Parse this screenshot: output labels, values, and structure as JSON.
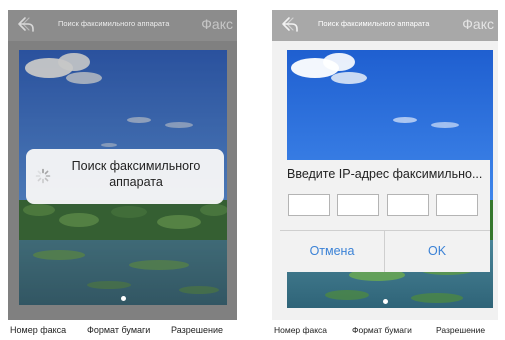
{
  "left_screen": {
    "nav_title": "Поиск факсимильного аппарата",
    "nav_right": "Факс",
    "popup_text": "Поиск факсимильного аппарата",
    "tabs": [
      "Номер факса",
      "Формат бумаги",
      "Разрешение"
    ]
  },
  "right_screen": {
    "nav_title": "Поиск факсимильного аппарата",
    "nav_right": "Факс",
    "dialog_title": "Введите IP-адрес факсимильно...",
    "ip_fields": [
      "",
      "",
      "",
      ""
    ],
    "cancel_label": "Отмена",
    "ok_label": "OK",
    "tabs": [
      "Номер факса",
      "Формат бумаги",
      "Разрешение"
    ]
  },
  "colors": {
    "navbar_left": "#8c8c8c",
    "navbar_right": "#a8a8a8",
    "accent_blue": "#3b82d6",
    "sky": "#2a63c9"
  },
  "icons": [
    "back-arrow-icon",
    "loading-spinner-icon",
    "page-indicator-dot"
  ]
}
